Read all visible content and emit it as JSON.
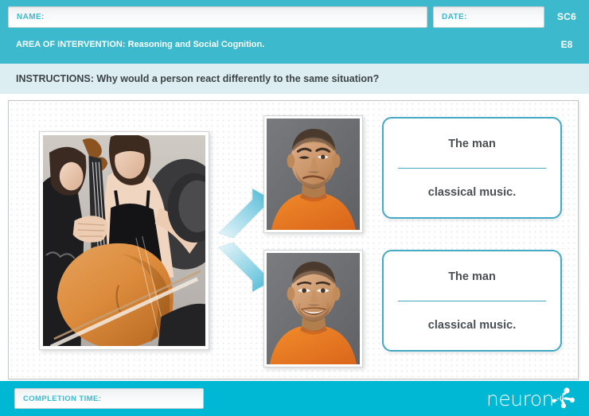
{
  "header": {
    "name_label": "NAME:",
    "name_value": "",
    "date_label": "DATE:",
    "date_value": "",
    "code_top": "SC6",
    "code_bottom": "E8",
    "area_label": "AREA OF INTERVENTION:",
    "area_value": " Reasoning and Social Cognition.",
    "bg_color": "#3cb9cd"
  },
  "instructions": {
    "label": "INSTRUCTIONS:",
    "text": " Why would a person react differently to the same situation?",
    "full": "INSTRUCTIONS: Why would a person react differently to the same situation?",
    "bg_color": "#dceef2"
  },
  "main": {
    "stimulus_image": {
      "name": "cello-players-photo",
      "description": "Two women playing cellos, close-up of cello body and bow"
    },
    "arrows": [
      {
        "name": "arrow-up-right",
        "direction": "up-right"
      },
      {
        "name": "arrow-down-right",
        "direction": "down-right"
      }
    ],
    "reactions": [
      {
        "photo": {
          "name": "man-displeased-photo",
          "description": "Man in orange t-shirt with displeased squinting expression on gray background"
        },
        "answer": {
          "line1": "The man",
          "blank": "",
          "line2": "classical music."
        }
      },
      {
        "photo": {
          "name": "man-smiling-photo",
          "description": "Man in orange t-shirt smiling on gray background"
        },
        "answer": {
          "line1": "The man",
          "blank": "",
          "line2": "classical music."
        }
      }
    ],
    "accent_color": "#43a9c4"
  },
  "footer": {
    "completion_label": "COMPLETION TIME:",
    "completion_value": "",
    "logo_text": "neuron",
    "logo_badge": "UP",
    "bg_color": "#00b7d4"
  }
}
